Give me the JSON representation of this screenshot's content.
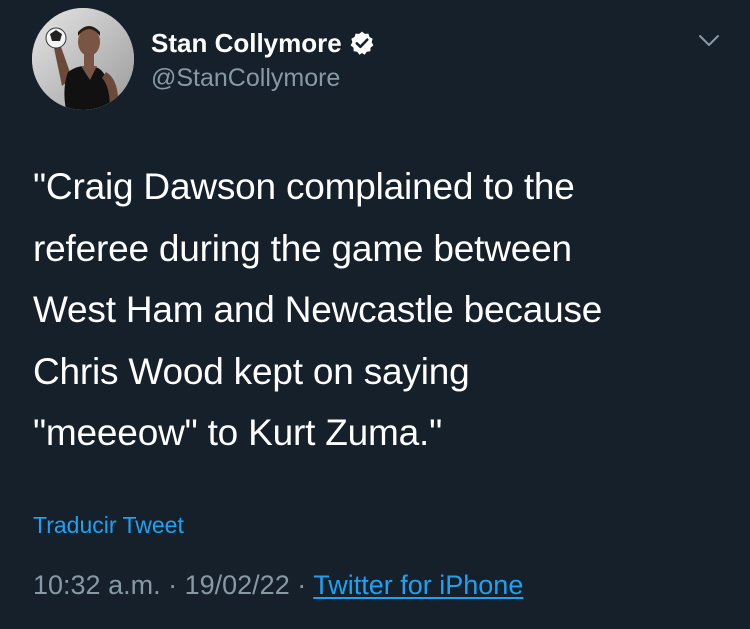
{
  "author": {
    "display_name": "Stan Collymore",
    "handle": "@StanCollymore",
    "verified": true,
    "verified_icon": "verified-badge-icon",
    "avatar": "profile-photo-avatar"
  },
  "tweet": {
    "lines": [
      "\"Craig Dawson complained to the",
      "referee during the game between",
      "West Ham and Newcastle because",
      "Chris Wood kept on saying",
      "\"meeeow\" to Kurt Zuma.\""
    ]
  },
  "translate_label": "Traducir Tweet",
  "meta": {
    "time": "10:32 a.m.",
    "separator": "·",
    "date": "19/02/22",
    "source": "Twitter for iPhone"
  },
  "menu_icon": "chevron-down-icon",
  "colors": {
    "background": "#15202b",
    "text": "#ffffff",
    "secondary": "#8899a6",
    "accent": "#1da1f2"
  }
}
